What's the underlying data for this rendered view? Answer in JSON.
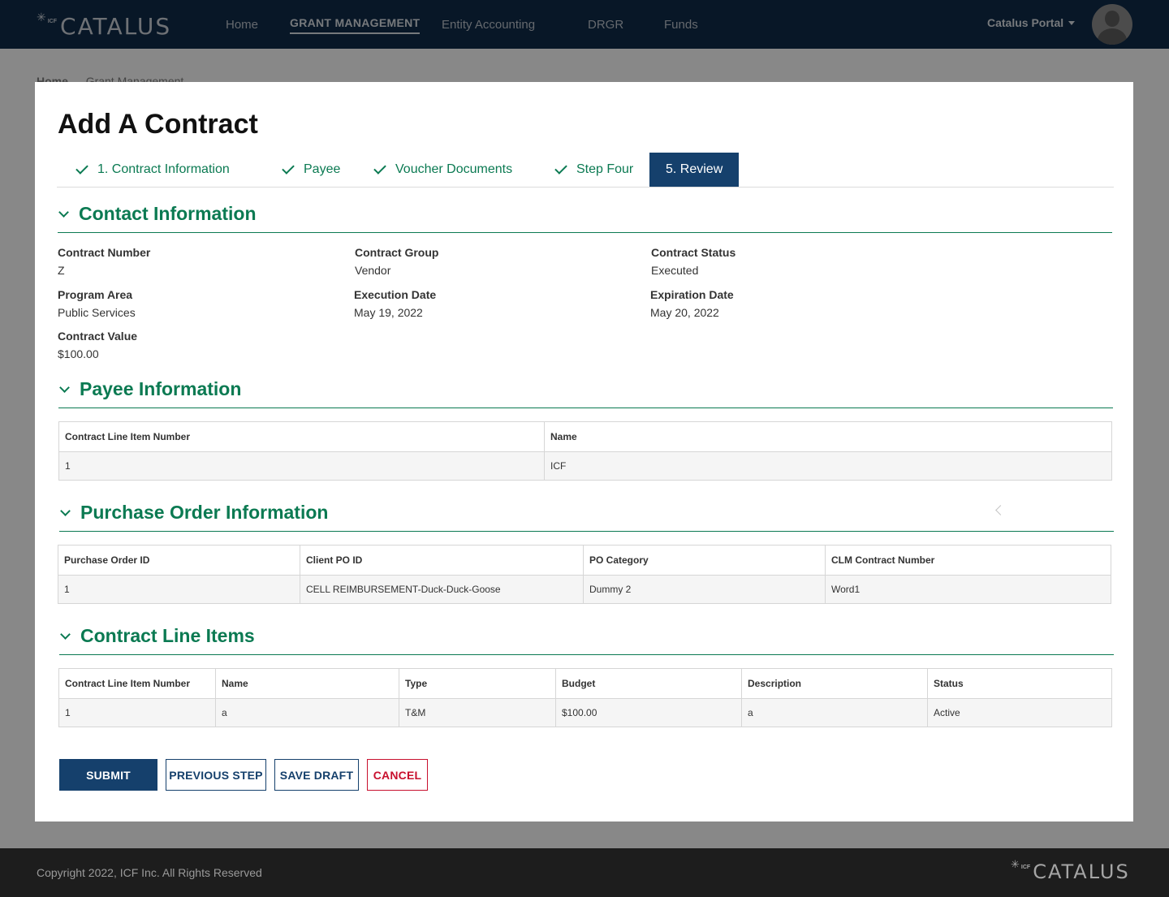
{
  "header": {
    "logo_icf": "ICF",
    "logo_text": "CATALUS",
    "nav": [
      "Home",
      "GRANT MANAGEMENT",
      "Entity Accounting",
      "DRGR",
      "Funds"
    ],
    "active_nav": "GRANT MANAGEMENT",
    "portal_label": "Catalus Portal"
  },
  "breadcrumb": {
    "home": "Home",
    "current": "Grant Management"
  },
  "modal": {
    "title": "Add A Contract",
    "steps": [
      {
        "label": "1. Contract Information",
        "completed": true
      },
      {
        "label": "Payee",
        "completed": true
      },
      {
        "label": "Voucher Documents",
        "completed": true
      },
      {
        "label": "Step Four",
        "completed": true
      },
      {
        "label": "5. Review",
        "active": true
      }
    ],
    "contact": {
      "heading": "Contact Information",
      "fields": [
        {
          "label": "Contract Number",
          "value": "Z"
        },
        {
          "label": "Contract Group",
          "value": "Vendor"
        },
        {
          "label": "Contract Status",
          "value": "Executed"
        },
        {
          "label": "Program Area",
          "value": "Public Services"
        },
        {
          "label": "Execution Date",
          "value": "May 19, 2022"
        },
        {
          "label": "Expiration Date",
          "value": "May 20, 2022"
        },
        {
          "label": "Contract Value",
          "value": "$100.00"
        }
      ]
    },
    "payee": {
      "heading": "Payee Information",
      "columns": [
        "Contract Line Item Number",
        "Name"
      ],
      "rows": [
        [
          "1",
          "ICF"
        ]
      ]
    },
    "purchase_order": {
      "heading": "Purchase Order Information",
      "columns": [
        "Purchase Order ID",
        "Client PO ID",
        "PO Category",
        "CLM Contract Number"
      ],
      "rows": [
        [
          "1",
          "CELL REIMBURSEMENT-Duck-Duck-Goose",
          "Dummy 2",
          "Word1"
        ]
      ]
    },
    "line_items": {
      "heading": "Contract Line Items",
      "columns": [
        "Contract Line Item Number",
        "Name",
        "Type",
        "Budget",
        "Description",
        "Status"
      ],
      "rows": [
        [
          "1",
          "a",
          "T&M",
          "$100.00",
          "a",
          "Active"
        ]
      ]
    },
    "buttons": {
      "submit": "SUBMIT",
      "previous": "PREVIOUS STEP",
      "save_draft": "SAVE DRAFT",
      "cancel": "CANCEL"
    }
  },
  "footer": {
    "copyright": "Copyright 2022, ICF Inc. All Rights Reserved",
    "logo_icf": "ICF",
    "logo_text": "CATALUS"
  },
  "colors": {
    "header_bg": "#0f2a47",
    "accent_green": "#0b7a52",
    "primary_blue": "#15406c",
    "danger_red": "#c8102e",
    "footer_bg": "#1d1d1d"
  }
}
